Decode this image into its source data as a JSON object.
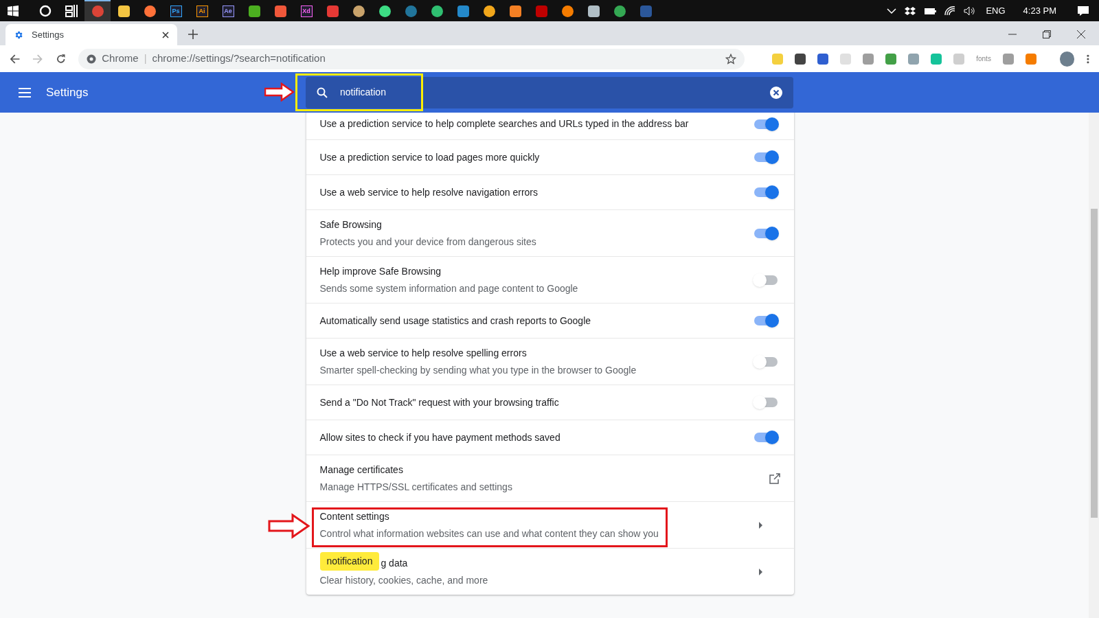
{
  "taskbar": {
    "apps": [
      {
        "color": "#ffffff",
        "kind": "cortana"
      },
      {
        "color": "#ffffff",
        "kind": "taskview"
      },
      {
        "color": "#db4437",
        "kind": "round",
        "selected": true
      },
      {
        "color": "#f4c542",
        "kind": "square",
        "selected": false
      },
      {
        "color": "#ff7139",
        "kind": "round",
        "selected": false
      },
      {
        "color": "#31a8ff",
        "kind": "label",
        "label": "Ps",
        "selected": false
      },
      {
        "color": "#ff9a00",
        "kind": "label",
        "label": "Ai",
        "selected": false
      },
      {
        "color": "#9999ff",
        "kind": "label",
        "label": "Ae",
        "selected": false
      },
      {
        "color": "#4caf20",
        "kind": "square",
        "selected": false
      },
      {
        "color": "#f0573a",
        "kind": "square",
        "selected": false
      },
      {
        "color": "#ff61f6",
        "kind": "label",
        "label": "Xd",
        "selected": false
      },
      {
        "color": "#e53935",
        "kind": "square",
        "selected": false
      },
      {
        "color": "#c9a36b",
        "kind": "round",
        "selected": false
      },
      {
        "color": "#3ddc84",
        "kind": "round",
        "selected": false
      },
      {
        "color": "#21759b",
        "kind": "round",
        "selected": false
      },
      {
        "color": "#2fbf71",
        "kind": "round",
        "selected": false
      },
      {
        "color": "#2489ca",
        "kind": "square",
        "selected": false
      },
      {
        "color": "#f2a71b",
        "kind": "round",
        "selected": false
      },
      {
        "color": "#f48024",
        "kind": "square",
        "selected": false
      },
      {
        "color": "#bf0000",
        "kind": "square",
        "selected": false
      },
      {
        "color": "#f57c00",
        "kind": "round",
        "selected": false
      },
      {
        "color": "#b0bec5",
        "kind": "square",
        "selected": false
      },
      {
        "color": "#34a853",
        "kind": "round",
        "selected": false
      },
      {
        "color": "#2b579a",
        "kind": "square",
        "selected": false
      }
    ],
    "language": "ENG",
    "time": "4:23 PM"
  },
  "tab": {
    "title": "Settings"
  },
  "address": {
    "site": "Chrome",
    "url": "chrome://settings/?search=notification",
    "separator": "|"
  },
  "extensions": [
    {
      "color": "#f4d03f"
    },
    {
      "color": "#444444"
    },
    {
      "color": "#2f5fd0"
    },
    {
      "color": "#e0e0e0"
    },
    {
      "color": "#9e9e9e"
    },
    {
      "color": "#43a047"
    },
    {
      "color": "#90a4ae"
    },
    {
      "color": "#15c39a"
    },
    {
      "color": "#cfcfcf"
    },
    {
      "label": "fonts"
    },
    {
      "color": "#9e9e9e"
    },
    {
      "color": "#f57c00"
    }
  ],
  "header": {
    "title": "Settings",
    "search": {
      "value": "notification",
      "highlighted": true
    }
  },
  "rows": [
    {
      "kind": "toggle",
      "title": "Use a prediction service to help complete searches and URLs typed in the address bar",
      "on": true
    },
    {
      "kind": "toggle",
      "title": "Use a prediction service to load pages more quickly",
      "on": true
    },
    {
      "kind": "toggle",
      "title": "Use a web service to help resolve navigation errors",
      "on": true
    },
    {
      "kind": "toggle",
      "title": "Safe Browsing",
      "subtitle": "Protects you and your device from dangerous sites",
      "on": true
    },
    {
      "kind": "toggle",
      "title": "Help improve Safe Browsing",
      "subtitle": "Sends some system information and page content to Google",
      "on": false
    },
    {
      "kind": "toggle",
      "title": "Automatically send usage statistics and crash reports to Google",
      "on": true
    },
    {
      "kind": "toggle",
      "title": "Use a web service to help resolve spelling errors",
      "subtitle": "Smarter spell-checking by sending what you type in the browser to Google",
      "on": false
    },
    {
      "kind": "toggle",
      "title": "Send a \"Do Not Track\" request with your browsing traffic",
      "on": false
    },
    {
      "kind": "toggle",
      "title": "Allow sites to check if you have payment methods saved",
      "on": true
    },
    {
      "kind": "external",
      "title": "Manage certificates",
      "subtitle": "Manage HTTPS/SSL certificates and settings"
    },
    {
      "kind": "arrow",
      "title": "Content settings",
      "subtitle": "Control what information websites can use and what content they can show you",
      "highlighted": true
    },
    {
      "kind": "arrow",
      "bubble": "notification",
      "title": "g data",
      "subtitle": "Clear history, cookies, cache, and more"
    }
  ]
}
